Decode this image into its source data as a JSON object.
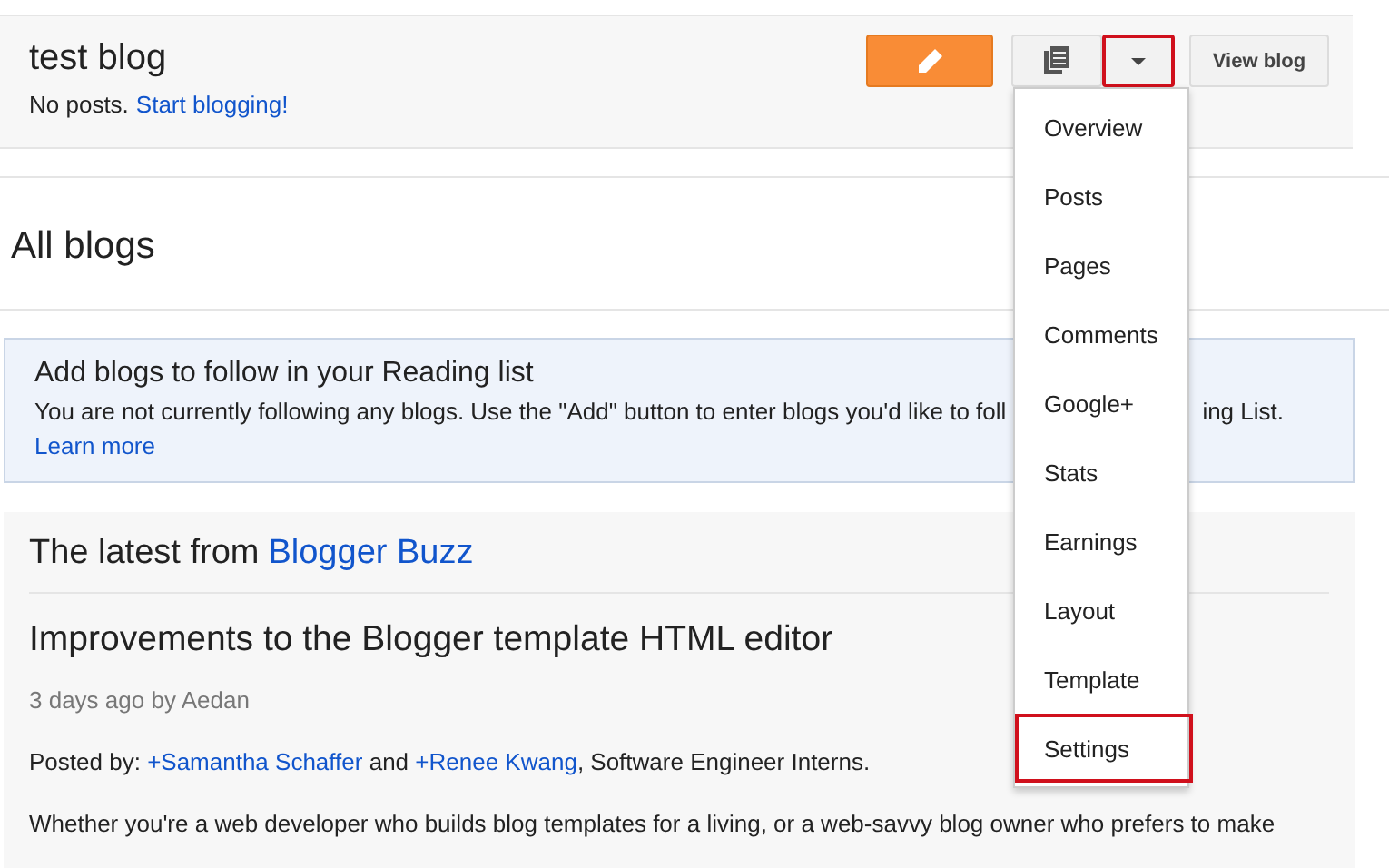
{
  "blog": {
    "title": "test blog",
    "status": "No posts.",
    "link": "Start blogging!"
  },
  "toolbar": {
    "view_button": "View blog",
    "dropdown_highlighted": true
  },
  "menu": {
    "items": [
      {
        "label": "Overview",
        "highlighted": false
      },
      {
        "label": "Posts",
        "highlighted": false
      },
      {
        "label": "Pages",
        "highlighted": false
      },
      {
        "label": "Comments",
        "highlighted": false
      },
      {
        "label": "Google+",
        "highlighted": false
      },
      {
        "label": "Stats",
        "highlighted": false
      },
      {
        "label": "Earnings",
        "highlighted": false
      },
      {
        "label": "Layout",
        "highlighted": false
      },
      {
        "label": "Template",
        "highlighted": false
      },
      {
        "label": "Settings",
        "highlighted": true
      }
    ]
  },
  "all_blogs": {
    "heading": "All blogs"
  },
  "reading_list": {
    "title": "Add blogs to follow in your Reading list",
    "text_left": "You are not currently following any blogs. Use the \"Add\" button to enter blogs you'd like to foll",
    "text_right": "ing List.",
    "link": "Learn more"
  },
  "buzz": {
    "heading": "The latest from",
    "heading_link": "Blogger Buzz",
    "post_title": "Improvements to the Blogger template HTML editor",
    "meta": "3 days ago by Aedan",
    "posted_by": "Posted by:",
    "author_1": "+Samantha Schaffer",
    "joiner": "and",
    "author_2": "+Renee Kwang",
    "role": ", Software Engineer Interns.",
    "body": "Whether you're a web developer who builds blog templates for a living, or a web-savvy blog owner who prefers to make"
  }
}
